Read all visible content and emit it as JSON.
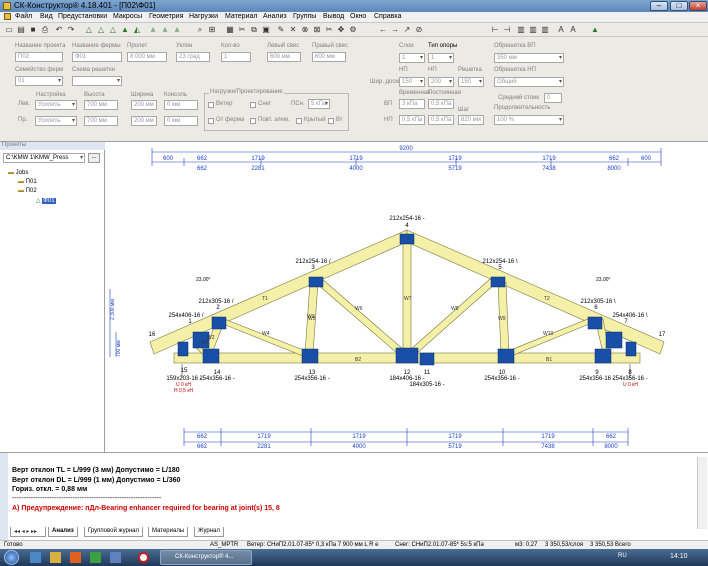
{
  "window": {
    "title": "СК-Конструктор® 4.18.401 - [П02\\Ф01]",
    "min": "–",
    "max": "□",
    "close": "×"
  },
  "menu": [
    "Файл",
    "Вид",
    "Предустановки",
    "Макросы",
    "Геометрия",
    "Нагрузки",
    "Материал",
    "Анализ",
    "Группы",
    "Вывод",
    "Окно",
    "Справка"
  ],
  "params": {
    "project_name_label": "Название проекта",
    "project_name": "П02",
    "truss_name_label": "Название фермы",
    "truss_name": "Ф01",
    "span_label": "Пролет",
    "span": "8 000 мм",
    "slope_label": "Уклон",
    "slope": "23 град",
    "qty_label": "Кол-во",
    "qty": "1",
    "left_overhang_label": "Левый свес",
    "left_overhang": "600 мм",
    "right_overhang_label": "Правый свес",
    "right_overhang": "600 мм",
    "layer_label": "Слои",
    "layer": "1",
    "support_type_label": "Тип опоры",
    "support_type": "1",
    "thickness_label": "Шир. доски",
    "thickness": "150",
    "np_label": "НП",
    "np": "200",
    "grid_label": "Решетка",
    "grid": "150",
    "truss_family_label": "Семейство ферм",
    "truss_family": "01",
    "web_scheme_label": "Схема решетки",
    "web_scheme": "",
    "setting_label": "Настройка",
    "left_setting_label": "Лев.",
    "left_setting": "Усилить",
    "right_setting_label": "Пр.",
    "right_setting": "Усилить",
    "height_label": "Высота",
    "height_left": "700 мм",
    "height_right": "700 мм",
    "width_label": "Ширина",
    "width_left": "200 мм",
    "width_right": "200 мм",
    "cantilever_label": "Консоль",
    "cantilever_left": "0 мм",
    "cantilever_right": "0 мм",
    "loads_group": "Нагрузки/Проектирование",
    "wind": "Ветер",
    "snow": "Снег",
    "psn_label": "ПСн.",
    "psn": "5 кПа",
    "on_truss": "От ферма",
    "repeat_sec": "Повт. элем.",
    "roofed": "Крытый",
    "vt": "Вт",
    "temporary_label": "Временная",
    "permanent_label": "Постоянная",
    "vp_label": "ВП",
    "vp_temp": "3 кПа",
    "vp_perm": "0,5 кПа",
    "np2_label": "НП",
    "np_temp": "0,5 кПа",
    "np_perm": "0,5 кПа",
    "step_label": "Шаг",
    "step": "820 мм",
    "common_vp_label": "Обрешетка ВП",
    "common_vp": "350 мм",
    "common_np_label": "Обрешетка НП",
    "common_np": "Общий",
    "middle_step_label": "Средний стоик",
    "middle_step": "0",
    "duration_label": "Продолжительность",
    "duration": "100 %"
  },
  "projects": {
    "header": "Проекты",
    "path": "C:\\KMW 1\\KMW_Press",
    "tree": [
      "Jobs",
      "П01",
      "П02",
      "Ф01"
    ]
  },
  "truss_labels": {
    "top_dims_blue": [
      "9200",
      "600",
      "662",
      "1719",
      "1719",
      "1719",
      "1719",
      "662",
      "600"
    ],
    "top_dims_blue2": [
      "662",
      "2281",
      "4000",
      "5719",
      "7438",
      "8000"
    ],
    "height_dims": [
      "2 300 мм",
      "700 мм"
    ],
    "nodes": [
      "212x254-16 -",
      "212x254-16 /",
      "212x254-16 \\",
      "212x305-16 /",
      "212x305-16 \\",
      "254x406-16 /",
      "254x406-16 \\",
      "254x356-16 -",
      "254x356-16 -",
      "254x356-16 -",
      "184x406-16 -",
      "184x305-16 -",
      "254x356-16 -",
      "254x356-16 -",
      "159x203-16 -"
    ],
    "node_numbers": [
      "4",
      "3",
      "5",
      "2",
      "6",
      "1",
      "7",
      "15",
      "14",
      "13",
      "12",
      "11",
      "10",
      "9",
      "8",
      "16",
      "17"
    ],
    "members": [
      "T1",
      "T2",
      "W1",
      "W2",
      "W3",
      "W4",
      "W5",
      "W6",
      "W7",
      "W8",
      "W9",
      "W10",
      "B1",
      "B2"
    ],
    "angles": [
      "23,00°",
      "23,00°"
    ],
    "reactions": [
      "U 0 кН",
      "H 0,5 кН",
      "U 0 кН"
    ],
    "bottom_dims": [
      "662",
      "1719",
      "1719",
      "1719",
      "1719",
      "662",
      "662",
      "2281",
      "4000",
      "5719",
      "7438",
      "8000"
    ]
  },
  "messages": [
    {
      "text": "Верт отклон TL = L/999  (3 мм)  Допустимо = L/180",
      "color": "#000000"
    },
    {
      "text": "Верт отклон DL = L/999  (1 мм)  Допустимо = L/360",
      "color": "#000000"
    },
    {
      "text": "Гориз. откл. = 0,88 мм",
      "color": "#000000"
    },
    {
      "text": "----------------------------------------------------------------",
      "color": "#000000"
    },
    {
      "text": "А) Предупреждение: пДл-Bearing enhancer required for bearing at joint(s) 15, 8",
      "color": "#cc0000"
    }
  ],
  "bottom_tabs": [
    "Анализ",
    "Групповой журнал",
    "Материалы",
    "Журнал"
  ],
  "status": {
    "ready": "Готово",
    "code": "AS_MPTR",
    "wind": "Ветер: СНиП2.01.07-85* 0,3 кПа 7 900 мм L R e",
    "snow": "Снег: СНиП2.01.07-85* 5s:5 кПа",
    "area": "м3: 0,27",
    "price1": "3 350,53/слоя",
    "price2": "3 350,53 Всего"
  },
  "taskbar": {
    "task": "СК-Конструктор® 4...",
    "clock": "14:10",
    "lang": "RU"
  },
  "colors": {
    "timber": "#f4f0a8",
    "timber_stroke": "#7a7a40",
    "plate": "#1a4fa8",
    "dim": "#1a3fc8",
    "warn": "#cc0000"
  }
}
